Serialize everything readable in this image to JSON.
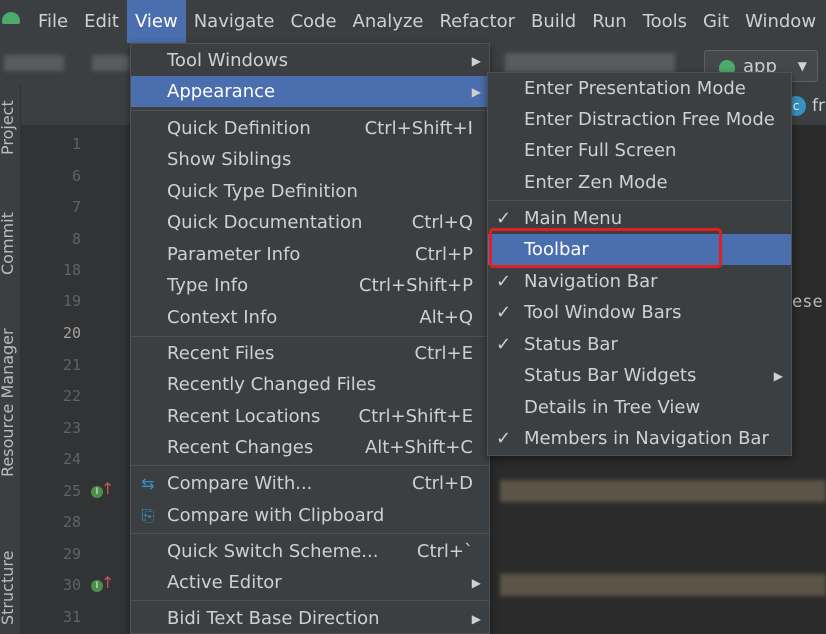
{
  "menubar": {
    "items": [
      "File",
      "Edit",
      "View",
      "Navigate",
      "Code",
      "Analyze",
      "Refactor",
      "Build",
      "Run",
      "Tools",
      "Git",
      "Window"
    ]
  },
  "toolbar": {
    "run_config": "app"
  },
  "editor_tab": {
    "icon": "c",
    "label": "fr"
  },
  "sidebar": {
    "labels": [
      "Project",
      "Commit",
      "Resource Manager",
      "Structure"
    ]
  },
  "gutter": {
    "lines": [
      "1",
      "6",
      "7",
      "8",
      "18",
      "19",
      "20",
      "21",
      "22",
      "23",
      "24",
      "25",
      "28",
      "29",
      "30",
      "31"
    ],
    "current_line": "20",
    "marker_letter": "I"
  },
  "code_fragment": "ese",
  "view_menu": {
    "items": [
      {
        "label": "Tool Windows",
        "shortcut": "",
        "submenu": true
      },
      {
        "label": "Appearance",
        "shortcut": "",
        "submenu": true,
        "selected": true
      },
      {
        "label": "Quick Definition",
        "shortcut": "Ctrl+Shift+I"
      },
      {
        "label": "Show Siblings",
        "shortcut": ""
      },
      {
        "label": "Quick Type Definition",
        "shortcut": ""
      },
      {
        "label": "Quick Documentation",
        "shortcut": "Ctrl+Q"
      },
      {
        "label": "Parameter Info",
        "shortcut": "Ctrl+P"
      },
      {
        "label": "Type Info",
        "shortcut": "Ctrl+Shift+P"
      },
      {
        "label": "Context Info",
        "shortcut": "Alt+Q"
      },
      {
        "label": "Recent Files",
        "shortcut": "Ctrl+E"
      },
      {
        "label": "Recently Changed Files",
        "shortcut": ""
      },
      {
        "label": "Recent Locations",
        "shortcut": "Ctrl+Shift+E"
      },
      {
        "label": "Recent Changes",
        "shortcut": "Alt+Shift+C"
      },
      {
        "label": "Compare With...",
        "shortcut": "Ctrl+D",
        "icon": "compare-icon"
      },
      {
        "label": "Compare with Clipboard",
        "shortcut": "",
        "icon": "compare-clipboard-icon"
      },
      {
        "label": "Quick Switch Scheme...",
        "shortcut": "Ctrl+`"
      },
      {
        "label": "Active Editor",
        "shortcut": "",
        "submenu": true
      },
      {
        "label": "Bidi Text Base Direction",
        "shortcut": "",
        "submenu": true
      }
    ]
  },
  "appearance_menu": {
    "items": [
      {
        "label": "Enter Presentation Mode",
        "checked": false
      },
      {
        "label": "Enter Distraction Free Mode",
        "checked": false
      },
      {
        "label": "Enter Full Screen",
        "checked": false
      },
      {
        "label": "Enter Zen Mode",
        "checked": false
      },
      {
        "label": "Main Menu",
        "checked": true
      },
      {
        "label": "Toolbar",
        "checked": false,
        "selected": true
      },
      {
        "label": "Navigation Bar",
        "checked": true
      },
      {
        "label": "Tool Window Bars",
        "checked": true
      },
      {
        "label": "Status Bar",
        "checked": true
      },
      {
        "label": "Status Bar Widgets",
        "checked": false,
        "submenu": true
      },
      {
        "label": "Details in Tree View",
        "checked": false
      },
      {
        "label": "Members in Navigation Bar",
        "checked": true
      }
    ]
  },
  "colors": {
    "menu_bg": "#3c3f41",
    "selection": "#4b6eaf",
    "editor_bg": "#2b2b2b",
    "highlight_box": "#e02020"
  }
}
